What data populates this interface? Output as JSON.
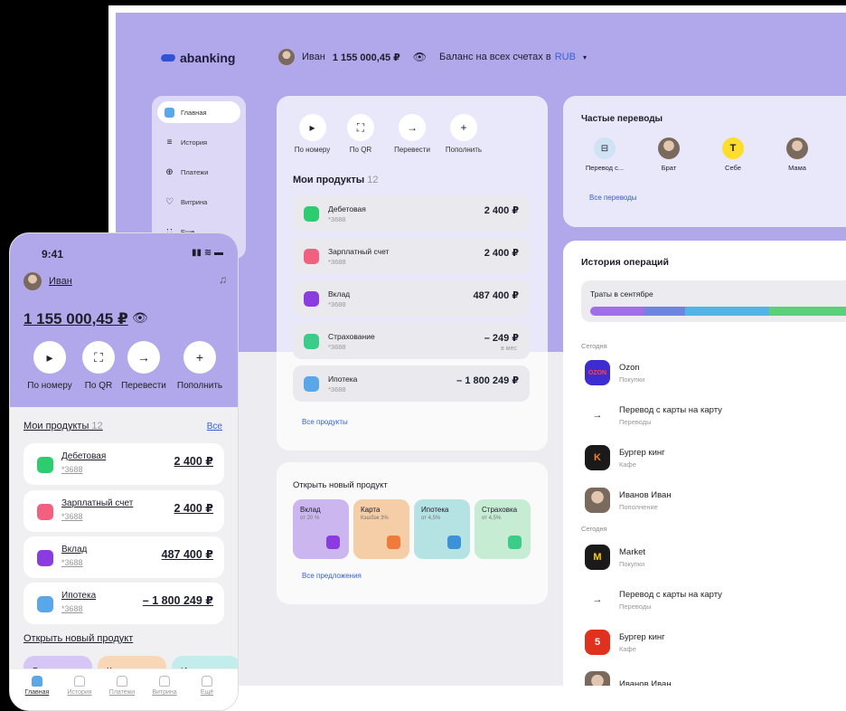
{
  "desktop": {
    "logo": "abanking",
    "user": {
      "name": "Иван",
      "balance": "1 155 000,45 ₽",
      "balance_label": "Баланс на всех счетах в",
      "currency": "RUB"
    },
    "sidebar": [
      {
        "label": "Главная",
        "icon": "home-icon"
      },
      {
        "label": "История",
        "icon": "list-icon"
      },
      {
        "label": "Платежи",
        "icon": "plus-circle-icon"
      },
      {
        "label": "Витрина",
        "icon": "heart-icon"
      },
      {
        "label": "Еще",
        "icon": "grid-icon"
      }
    ],
    "quick_actions": [
      {
        "label": "По номеру",
        "icon": "sbp-icon"
      },
      {
        "label": "По QR",
        "icon": "qr-icon"
      },
      {
        "label": "Перевести",
        "icon": "arrow-right-icon"
      },
      {
        "label": "Пополнить",
        "icon": "plus-icon"
      }
    ],
    "products": {
      "title": "Мои продукты",
      "count": "12",
      "all_link": "Все продукты",
      "items": [
        {
          "name": "Дебетовая",
          "num": "*3688",
          "amount": "2 400 ₽",
          "sub": "",
          "color": "#2ecc71"
        },
        {
          "name": "Зарплатный счет",
          "num": "*3688",
          "amount": "2 400 ₽",
          "sub": "",
          "color": "#f2607f"
        },
        {
          "name": "Вклад",
          "num": "*3688",
          "amount": "487 400 ₽",
          "sub": "",
          "color": "#8a3ce0"
        },
        {
          "name": "Страхование",
          "num": "*3688",
          "amount": "– 249 ₽",
          "sub": "в мес",
          "color": "#3ccc8a"
        },
        {
          "name": "Ипотека",
          "num": "*3688",
          "amount": "– 1 800 249 ₽",
          "sub": "",
          "color": "#59a7e8"
        }
      ]
    },
    "new_product": {
      "title": "Открыть новый продукт",
      "all_link": "Все предложения",
      "tiles": [
        {
          "name": "Вклад",
          "sub": "от 20 %",
          "bg": "#cbb6f0",
          "ic": "#8a3ce0"
        },
        {
          "name": "Карта",
          "sub": "Кэшбэк 3%",
          "bg": "#f5cda6",
          "ic": "#f07a3a"
        },
        {
          "name": "Ипотека",
          "sub": "от 4,5%",
          "bg": "#b5e2e2",
          "ic": "#3c91d8"
        },
        {
          "name": "Страховка",
          "sub": "от 4,5%",
          "bg": "#c6ecd4",
          "ic": "#3ccc8a"
        }
      ]
    },
    "frequent": {
      "title": "Частые переводы",
      "all_link": "Все переводы",
      "items": [
        {
          "label": "Перевод с...",
          "icon": "card-icon"
        },
        {
          "label": "Брат",
          "icon": "avatar"
        },
        {
          "label": "Себе",
          "icon": "t-icon"
        },
        {
          "label": "Мама",
          "icon": "avatar"
        }
      ]
    },
    "history": {
      "title": "История операций",
      "spend_title": "Траты в сентябре",
      "spend_colors": [
        "#a06ee8",
        "#6e85e0",
        "#55b4e6",
        "#5ccf78"
      ],
      "sections": [
        "Сегодня",
        "Сегодня"
      ],
      "ops": [
        {
          "title": "Ozon",
          "sub": "Покупки",
          "icon": "ozon-icon",
          "color": "#3d2cd2",
          "glyph": "OZON"
        },
        {
          "title": "Перевод с карты на карту",
          "sub": "Переводы",
          "icon": "arrow-right-icon",
          "color": "#e4e4ea",
          "glyph": "→"
        },
        {
          "title": "Бургер кинг",
          "sub": "Кафе",
          "icon": "bk-icon",
          "color": "#1a1a1a",
          "glyph": "K"
        },
        {
          "title": "Иванов Иван",
          "sub": "Пополнение",
          "icon": "avatar",
          "color": "#999",
          "glyph": ""
        },
        {
          "title": "Market",
          "sub": "Покупки",
          "icon": "market-icon",
          "color": "#1a1a1a",
          "glyph": "M"
        },
        {
          "title": "Перевод с карты на карту",
          "sub": "Переводы",
          "icon": "arrow-right-icon",
          "color": "#e4e4ea",
          "glyph": "→"
        },
        {
          "title": "Бургер кинг",
          "sub": "Кафе",
          "icon": "five-icon",
          "color": "#e0301e",
          "glyph": "5"
        },
        {
          "title": "Иванов Иван",
          "sub": "",
          "icon": "avatar",
          "color": "#999",
          "glyph": ""
        }
      ]
    }
  },
  "phone": {
    "time": "9:41",
    "user": "Иван",
    "balance": "1 155 000,45 ₽",
    "quick_actions": [
      {
        "label": "По номеру"
      },
      {
        "label": "По QR"
      },
      {
        "label": "Перевести"
      },
      {
        "label": "Пополнить"
      }
    ],
    "products_title": "Мои продукты",
    "products_count": "12",
    "all": "Все",
    "products": [
      {
        "name": "Дебетовая",
        "num": "*3688",
        "amount": "2 400 ₽",
        "color": "#2ecc71"
      },
      {
        "name": "Зарплатный счет",
        "num": "*3688",
        "amount": "2 400 ₽",
        "color": "#f2607f"
      },
      {
        "name": "Вклад",
        "num": "*3688",
        "amount": "487 400 ₽",
        "color": "#8a3ce0"
      },
      {
        "name": "Ипотека",
        "num": "*3688",
        "amount": "– 1 800 249 ₽",
        "color": "#59a7e8"
      }
    ],
    "new_product_title": "Открыть новый продукт",
    "tiles": [
      {
        "name": "Вклад",
        "bg": "#d6c6f5"
      },
      {
        "name": "Карта",
        "bg": "#f8d7b6"
      },
      {
        "name": "Ипотека",
        "bg": "#c3ecec"
      }
    ],
    "tabs": [
      "Главная",
      "История",
      "Платежи",
      "Витрина",
      "Ещё"
    ]
  }
}
